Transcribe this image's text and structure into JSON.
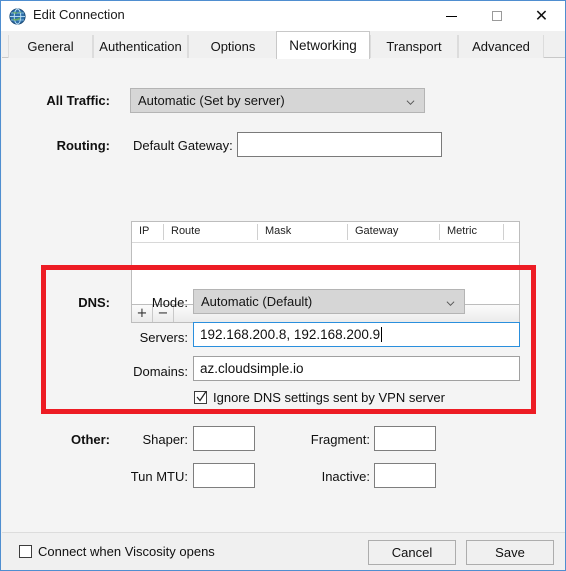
{
  "window": {
    "title": "Edit Connection",
    "app_icon": "globe-icon",
    "controls": {
      "minimize": "minimize-icon",
      "maximize": "maximize-icon",
      "close": "close-icon"
    },
    "border_color": "#4f8ed0"
  },
  "tabs": [
    {
      "label": "General",
      "active": false
    },
    {
      "label": "Authentication",
      "active": false
    },
    {
      "label": "Options",
      "active": false
    },
    {
      "label": "Networking",
      "active": true
    },
    {
      "label": "Transport",
      "active": false
    },
    {
      "label": "Advanced",
      "active": false
    }
  ],
  "sections": {
    "all_traffic": {
      "label": "All Traffic:",
      "dropdown_value": "Automatic (Set by server)",
      "chevron": "chevron-down-icon"
    },
    "routing": {
      "label": "Routing:",
      "gateway_label": "Default Gateway:",
      "gateway_value": "",
      "gateway_placeholder": "",
      "table": {
        "columns": [
          "IP",
          "Route",
          "Mask",
          "Gateway",
          "Metric"
        ],
        "rows": []
      },
      "toolbar": {
        "add_label": "+",
        "remove_label": "−"
      }
    },
    "dns": {
      "label": "DNS:",
      "highlight_color": "#ed1c24",
      "mode_label": "Mode:",
      "mode_value": "Automatic (Default)",
      "mode_chevron": "chevron-down-icon",
      "servers_label": "Servers:",
      "servers_value": "192.168.200.8, 192.168.200.9",
      "servers_focused": true,
      "domains_label": "Domains:",
      "domains_value": "az.cloudsimple.io",
      "ignore_checkbox": {
        "label": "Ignore DNS settings sent by VPN server",
        "checked": true
      }
    },
    "other": {
      "label": "Other:",
      "shaper_label": "Shaper:",
      "shaper_value": "",
      "fragment_label": "Fragment:",
      "fragment_value": "",
      "tun_mtu_label": "Tun MTU:",
      "tun_mtu_value": "",
      "inactive_label": "Inactive:",
      "inactive_value": ""
    }
  },
  "footer": {
    "connect_checkbox": {
      "label": "Connect when Viscosity opens",
      "checked": false
    },
    "cancel_label": "Cancel",
    "save_label": "Save"
  }
}
